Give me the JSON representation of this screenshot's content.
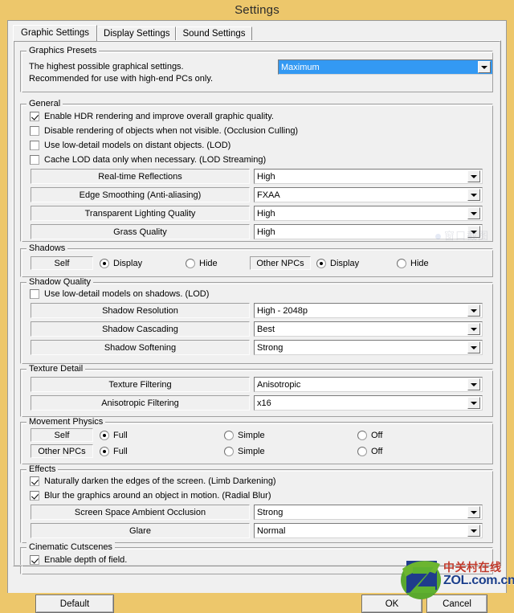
{
  "window": {
    "title": "Settings"
  },
  "tabs": [
    {
      "label": "Graphic Settings",
      "selected": true
    },
    {
      "label": "Display Settings",
      "selected": false
    },
    {
      "label": "Sound Settings",
      "selected": false
    }
  ],
  "groups": {
    "presets": {
      "legend": "Graphics Presets",
      "desc_line1": "The highest possible graphical settings.",
      "desc_line2": "Recommended for use with high-end PCs only.",
      "value": "Maximum"
    },
    "general": {
      "legend": "General",
      "checkboxes": [
        {
          "label": "Enable HDR rendering and improve overall graphic quality.",
          "checked": true
        },
        {
          "label": "Disable rendering of objects when not visible. (Occlusion Culling)",
          "checked": false
        },
        {
          "label": "Use low-detail models on distant objects. (LOD)",
          "checked": false
        },
        {
          "label": "Cache LOD data only when necessary. (LOD Streaming)",
          "checked": false
        }
      ],
      "rows": [
        {
          "caption": "Real-time Reflections",
          "value": "High"
        },
        {
          "caption": "Edge Smoothing (Anti-aliasing)",
          "value": "FXAA"
        },
        {
          "caption": "Transparent Lighting Quality",
          "value": "High"
        },
        {
          "caption": "Grass Quality",
          "value": "High"
        }
      ]
    },
    "shadows": {
      "legend": "Shadows",
      "rows": [
        {
          "caption": "Self",
          "options": [
            {
              "label": "Display",
              "checked": true
            },
            {
              "label": "Hide",
              "checked": false
            }
          ]
        },
        {
          "caption": "Other NPCs",
          "options": [
            {
              "label": "Display",
              "checked": true
            },
            {
              "label": "Hide",
              "checked": false
            }
          ]
        }
      ]
    },
    "shadow_quality": {
      "legend": "Shadow Quality",
      "checkboxes": [
        {
          "label": "Use low-detail models on shadows. (LOD)",
          "checked": false
        }
      ],
      "rows": [
        {
          "caption": "Shadow Resolution",
          "value": "High - 2048p"
        },
        {
          "caption": "Shadow Cascading",
          "value": "Best"
        },
        {
          "caption": "Shadow Softening",
          "value": "Strong"
        }
      ]
    },
    "texture_detail": {
      "legend": "Texture Detail",
      "rows": [
        {
          "caption": "Texture Filtering",
          "value": "Anisotropic"
        },
        {
          "caption": "Anisotropic Filtering",
          "value": "x16"
        }
      ]
    },
    "movement_physics": {
      "legend": "Movement Physics",
      "rows": [
        {
          "caption": "Self",
          "options": [
            {
              "label": "Full",
              "checked": true
            },
            {
              "label": "Simple",
              "checked": false
            },
            {
              "label": "Off",
              "checked": false
            }
          ]
        },
        {
          "caption": "Other NPCs",
          "options": [
            {
              "label": "Full",
              "checked": true
            },
            {
              "label": "Simple",
              "checked": false
            },
            {
              "label": "Off",
              "checked": false
            }
          ]
        }
      ]
    },
    "effects": {
      "legend": "Effects",
      "checkboxes": [
        {
          "label": "Naturally darken the edges of the screen. (Limb Darkening)",
          "checked": true
        },
        {
          "label": "Blur the graphics around an object in motion. (Radial Blur)",
          "checked": true
        }
      ],
      "rows": [
        {
          "caption": "Screen Space Ambient Occlusion",
          "value": "Strong"
        },
        {
          "caption": "Glare",
          "value": "Normal"
        }
      ]
    },
    "cinematic": {
      "legend": "Cinematic Cutscenes",
      "checkboxes": [
        {
          "label": "Enable depth of field.",
          "checked": true
        }
      ]
    }
  },
  "buttons": {
    "default": "Default",
    "ok": "OK",
    "cancel": "Cancel"
  },
  "watermark": {
    "faint": "窗口截图",
    "logo_cn": "中关村在线",
    "logo_en": "ZOL.com.cn",
    "logo_letter": "Z"
  },
  "colors": {
    "titlebar": "#edc76b",
    "dialog_face": "#f0f0f0",
    "selection_blue": "#3399f3"
  }
}
